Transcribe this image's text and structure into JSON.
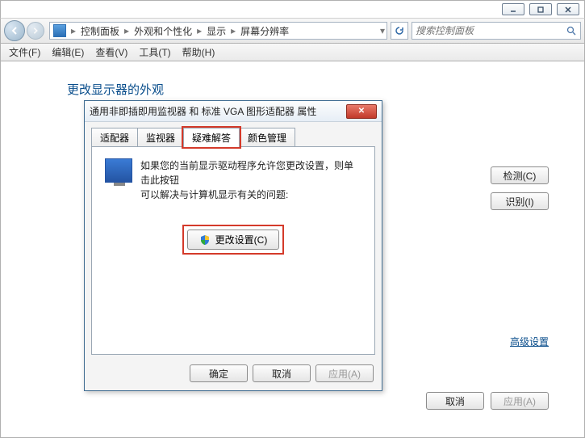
{
  "window_controls": {
    "min": "min",
    "max": "max",
    "close": "close"
  },
  "breadcrumb": {
    "items": [
      "控制面板",
      "外观和个性化",
      "显示",
      "屏幕分辨率"
    ]
  },
  "search": {
    "placeholder": "搜索控制面板"
  },
  "menu": {
    "file": "文件(F)",
    "edit": "编辑(E)",
    "view": "查看(V)",
    "tools": "工具(T)",
    "help": "帮助(H)"
  },
  "page": {
    "title": "更改显示器的外观"
  },
  "side": {
    "detect": "检测(C)",
    "identify": "识别(I)"
  },
  "advanced": "高级设置",
  "bottom": {
    "cancel": "取消",
    "apply": "应用(A)"
  },
  "dialog": {
    "title": "通用非即插即用监视器 和 标准 VGA 图形适配器 属性",
    "tabs": {
      "adapter": "适配器",
      "monitor": "监视器",
      "troubleshoot": "疑难解答",
      "color": "颜色管理"
    },
    "body_line1": "如果您的当前显示驱动程序允许您更改设置，则单击此按钮",
    "body_line2": "可以解决与计算机显示有关的问题:",
    "change_settings": "更改设置(C)",
    "ok": "确定",
    "cancel": "取消",
    "apply": "应用(A)"
  }
}
